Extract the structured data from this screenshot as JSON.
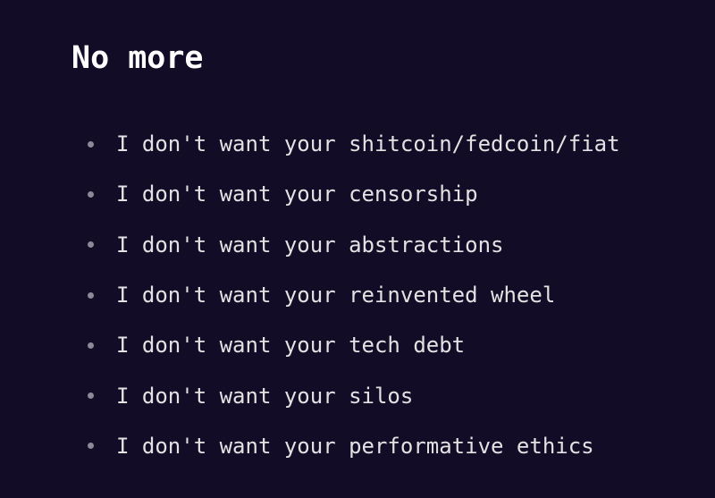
{
  "slide": {
    "title": "No more",
    "bullets": [
      "I don't want your shitcoin/fedcoin/fiat",
      "I don't want your censorship",
      "I don't want your abstractions",
      "I don't want your reinvented wheel",
      "I don't want your tech debt",
      "I don't want your silos",
      "I don't want your performative ethics"
    ]
  },
  "colors": {
    "background": "#120c26",
    "title": "#ffffff",
    "text": "#e2e2e2",
    "bullet": "#8c8a98"
  }
}
